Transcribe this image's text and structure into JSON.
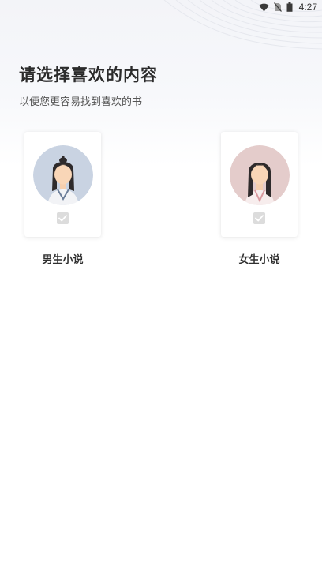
{
  "status_bar": {
    "time": "4:27",
    "icons": [
      "wifi-icon",
      "no-sim-icon",
      "battery-icon"
    ]
  },
  "header": {
    "title": "请选择喜欢的内容",
    "subtitle": "以便您更容易找到喜欢的书"
  },
  "categories": [
    {
      "label": "男生小说",
      "avatar": "male-avatar-icon",
      "avatar_bg": "#c9d3e2",
      "checked": false
    },
    {
      "label": "女生小说",
      "avatar": "female-avatar-icon",
      "avatar_bg": "#e4cccb",
      "checked": false
    }
  ],
  "colors": {
    "checkbox_bg": "#dcdcdc",
    "checkbox_mark": "#ffffff",
    "title_text": "#2b2b2b"
  }
}
